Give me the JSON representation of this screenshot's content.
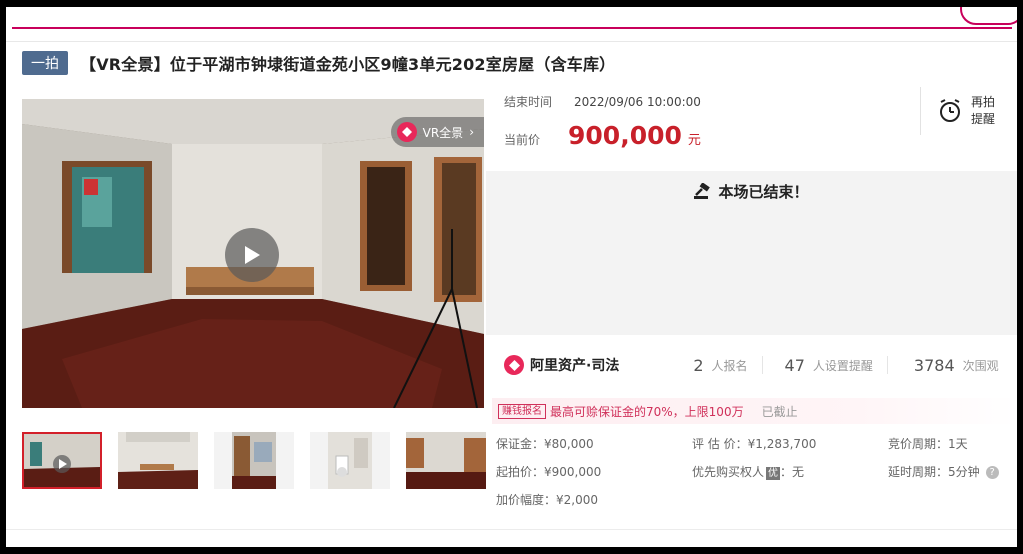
{
  "badge": "一拍",
  "title": "【VR全景】位于平湖市钟埭街道金苑小区9幢3单元202室房屋（含车库）",
  "photo": {
    "vr_label": "VR全景"
  },
  "auction": {
    "end_time_label": "结束时间",
    "end_time_value": "2022/09/06 10:00:00",
    "current_price_label": "当前价",
    "current_price": "900,000",
    "currency_unit": "元",
    "remind_label": "再拍提醒",
    "ended_message": "本场已结束！"
  },
  "platform": {
    "name": "阿里资产·司法",
    "registrants_num": "2",
    "registrants_label": "人报名",
    "reminders_num": "47",
    "reminders_label": "人设置提醒",
    "watchers_num": "3784",
    "watchers_label": "次围观"
  },
  "bail": {
    "tag": "赚钱报名",
    "text": "最高可赊保证金的70%，上限100万",
    "status": "已截止"
  },
  "details": {
    "deposit": "保证金：¥80,000",
    "appraisal": "评 估 价：¥1,283,700",
    "cycle": "竞价周期：1天",
    "start_price": "起拍价：¥900,000",
    "priority_label": "优先购买权人",
    "priority_icon": "优",
    "priority_value": "：无",
    "extension": "延时周期：5分钟",
    "increment": "加价幅度：¥2,000"
  },
  "colors": {
    "accent": "#c8202a",
    "brand": "#e8285a",
    "badge": "#4f6b8f"
  }
}
